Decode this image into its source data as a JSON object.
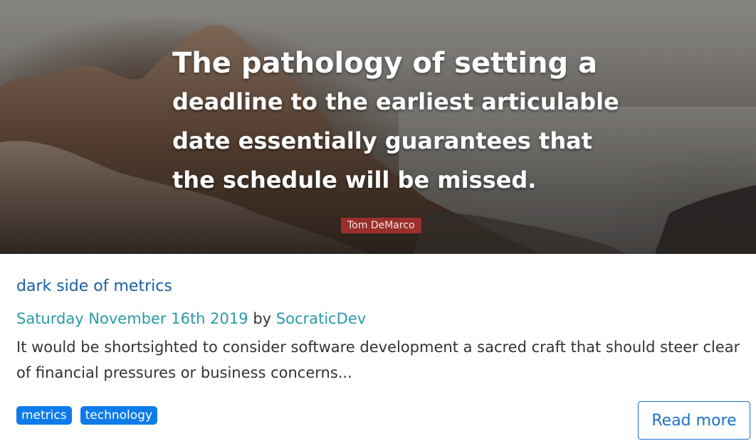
{
  "hero": {
    "quote_lines": [
      "The pathology of setting a",
      "deadline to the earliest articulable",
      "date essentially guarantees that",
      "the schedule will be missed."
    ],
    "author": "Tom DeMarco"
  },
  "post": {
    "title": "dark side of metrics",
    "date": "Saturday November 16th 2019",
    "by": "by",
    "author": "SocraticDev",
    "excerpt": "It would be shortsighted to consider software development a sacred craft that should steer clear of financial pressures or business concerns...",
    "tags": [
      "metrics",
      "technology"
    ],
    "read_more": "Read more"
  },
  "colors": {
    "title": "#1c5fa3",
    "link": "#2a9aa8",
    "tag_bg": "#0d7bea",
    "button_border": "#1a73c9",
    "author_badge": "#9b2f2b"
  }
}
